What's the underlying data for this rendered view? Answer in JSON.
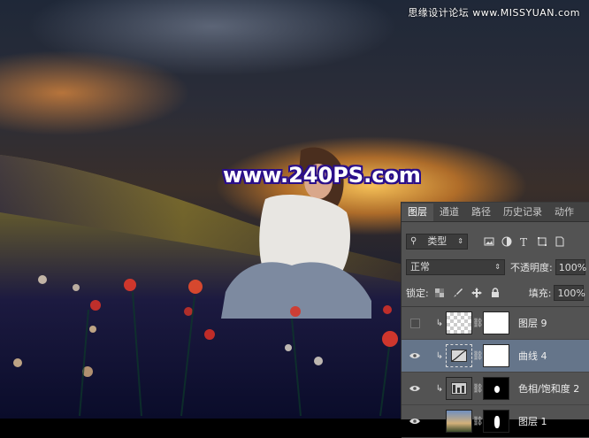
{
  "watermark": {
    "top_text": "思缘设计论坛 www.MISSYUAN.com",
    "main_text": "www.240PS.com"
  },
  "layers_panel": {
    "tabs": [
      {
        "label": "图层",
        "active": true
      },
      {
        "label": "通道",
        "active": false
      },
      {
        "label": "路径",
        "active": false
      },
      {
        "label": "历史记录",
        "active": false
      },
      {
        "label": "动作",
        "active": false
      }
    ],
    "filter": {
      "label": "类型",
      "icons": [
        "image-filter-icon",
        "adjustment-filter-icon",
        "type-filter-icon",
        "shape-filter-icon",
        "smart-object-filter-icon"
      ]
    },
    "blend_mode": "正常",
    "opacity": {
      "label": "不透明度:",
      "value": "100%"
    },
    "lock": {
      "label": "锁定:",
      "icons": [
        "lock-transparent-icon",
        "lock-paint-icon",
        "lock-position-icon",
        "lock-all-icon"
      ]
    },
    "fill": {
      "label": "填充:",
      "value": "100%"
    },
    "layers": [
      {
        "name": "图层 9",
        "visible": false,
        "selected": false,
        "clipped": true
      },
      {
        "name": "曲线 4",
        "visible": true,
        "selected": true,
        "clipped": true
      },
      {
        "name": "色相/饱和度 2",
        "visible": true,
        "selected": false,
        "clipped": true
      },
      {
        "name": "图层 1",
        "visible": true,
        "selected": false,
        "clipped": false
      }
    ]
  },
  "colors": {
    "panel_bg": "#535353",
    "selected_layer": "#65758a",
    "watermark_outline": "#2a0f8a"
  }
}
